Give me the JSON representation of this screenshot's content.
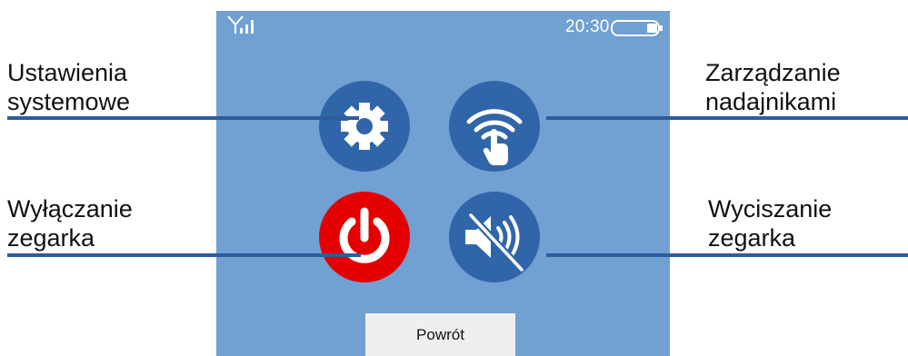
{
  "status_bar": {
    "time": "20:30",
    "signal_icon": "signal-antenna-icon",
    "battery_icon": "battery-icon"
  },
  "buttons": [
    {
      "icon": "gear-icon",
      "color": "#3065a9"
    },
    {
      "icon": "wifi-touch-icon",
      "color": "#3065a9"
    },
    {
      "icon": "power-icon",
      "color": "#e50000"
    },
    {
      "icon": "speaker-muted-icon",
      "color": "#3065a9"
    }
  ],
  "back_button": {
    "label": "Powrót"
  },
  "callouts": {
    "settings": {
      "line1": "Ustawienia",
      "line2": "systemowe"
    },
    "transmitters": {
      "line1": "Zarządzanie",
      "line2": "nadajnikami"
    },
    "power_off": {
      "line1": "Wyłączanie",
      "line2": "zegarka"
    },
    "mute": {
      "line1": "Wyciszanie",
      "line2": "zegarka"
    }
  },
  "colors": {
    "screen_bg": "#71a0d2",
    "icon_button": "#3065a9",
    "power_button": "#e50000",
    "leader_line": "#2e5c9c",
    "back_button_bg": "#efefef"
  }
}
